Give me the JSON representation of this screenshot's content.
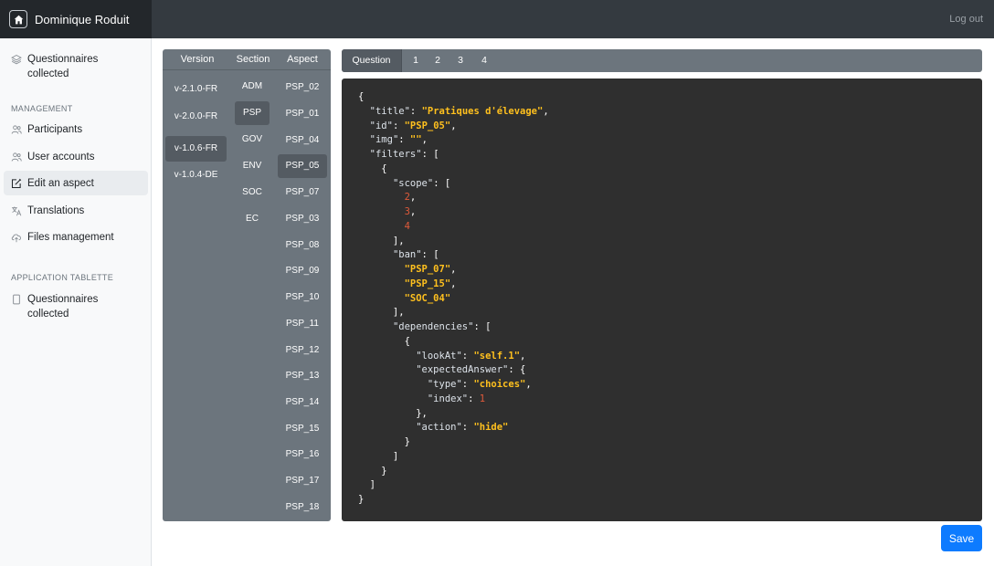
{
  "header": {
    "user_name": "Dominique Roduit",
    "logout_label": "Log out"
  },
  "sidebar": {
    "top_item": "Questionnaires collected",
    "management_heading": "MANAGEMENT",
    "management_items": [
      {
        "label": "Participants",
        "icon": "participants-icon"
      },
      {
        "label": "User accounts",
        "icon": "users-icon"
      },
      {
        "label": "Edit an aspect",
        "icon": "edit-icon",
        "active": true
      },
      {
        "label": "Translations",
        "icon": "translate-icon"
      },
      {
        "label": "Files management",
        "icon": "cloud-upload-icon"
      }
    ],
    "tablet_heading": "APPLICATION TABLETTE",
    "tablet_item": "Questionnaires collected"
  },
  "selector": {
    "headers": {
      "version": "Version",
      "section": "Section",
      "aspect": "Aspect"
    },
    "versions": [
      "v-2.1.0-FR",
      "v-2.0.0-FR",
      "v-1.0.6-FR",
      "v-1.0.4-DE"
    ],
    "selected_version": "v-1.0.6-FR",
    "sections": [
      "ADM",
      "PSP",
      "GOV",
      "ENV",
      "SOC",
      "EC"
    ],
    "selected_section": "PSP",
    "aspects": [
      "PSP_02",
      "PSP_01",
      "PSP_04",
      "PSP_05",
      "PSP_07",
      "PSP_03",
      "PSP_08",
      "PSP_09",
      "PSP_10",
      "PSP_11",
      "PSP_12",
      "PSP_13",
      "PSP_14",
      "PSP_15",
      "PSP_16",
      "PSP_17",
      "PSP_18"
    ],
    "selected_aspect": "PSP_05"
  },
  "editor": {
    "tabs": [
      "Question",
      "1",
      "2",
      "3",
      "4"
    ],
    "active_tab": "Question",
    "json": {
      "title": "Pratiques d'élevage",
      "id": "PSP_05",
      "img": "",
      "scope": [
        2,
        3,
        4
      ],
      "ban": [
        "PSP_07",
        "PSP_15",
        "SOC_04"
      ],
      "lookAt": "self.1",
      "type": "choices",
      "index": 1,
      "action": "hide"
    }
  },
  "save_label": "Save",
  "colors": {
    "topbar": "#343a40",
    "panel": "#6c757d",
    "editor_bg": "#2f2f2f",
    "string": "#ffc01e",
    "number": "#e05a3a",
    "primary": "#0d7bff"
  }
}
